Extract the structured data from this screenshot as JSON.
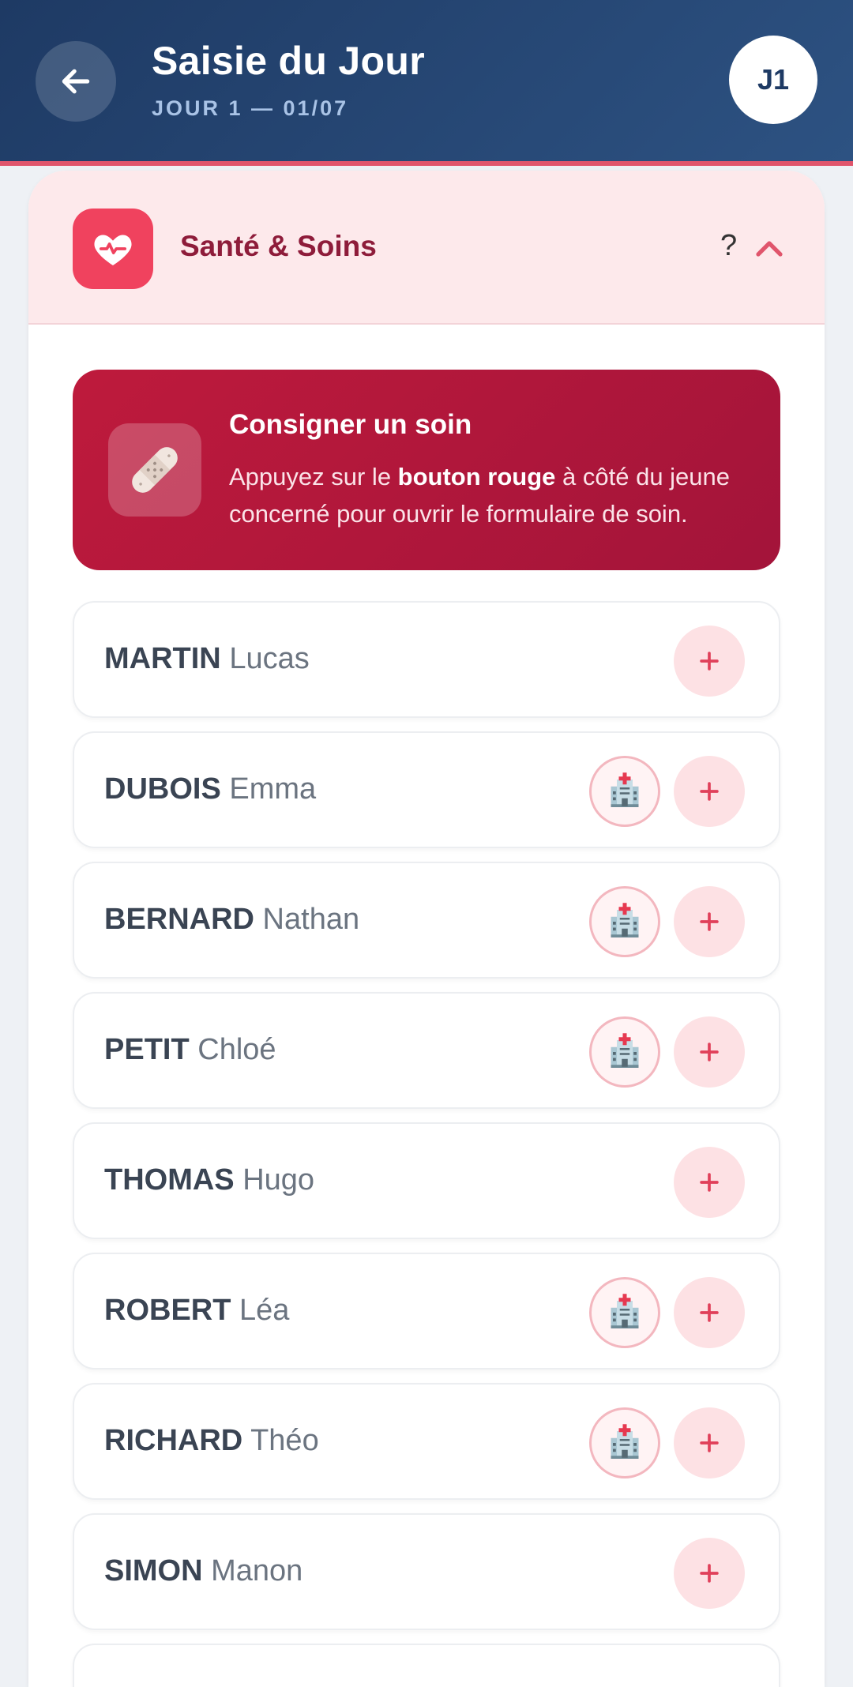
{
  "header": {
    "title": "Saisie du Jour",
    "subtitle": "JOUR 1 — 01/07",
    "day_badge": "J1",
    "back_icon": "arrow-left-icon",
    "accent": "#e0556c"
  },
  "section": {
    "title": "Santé & Soins",
    "help": "?",
    "icon": "heart-pulse-icon",
    "expanded": true
  },
  "info": {
    "title": "Consigner un soin",
    "text_before": "Appuyez sur le ",
    "text_bold": "bouton rouge",
    "text_after": " à côté du jeune concerné pour ouvrir le formulaire de soin.",
    "icon": "bandage-icon"
  },
  "rows": [
    {
      "last": "MARTIN",
      "first": "Lucas",
      "has_record": false
    },
    {
      "last": "DUBOIS",
      "first": "Emma",
      "has_record": true
    },
    {
      "last": "BERNARD",
      "first": "Nathan",
      "has_record": true
    },
    {
      "last": "PETIT",
      "first": "Chloé",
      "has_record": true
    },
    {
      "last": "THOMAS",
      "first": "Hugo",
      "has_record": false
    },
    {
      "last": "ROBERT",
      "first": "Léa",
      "has_record": true
    },
    {
      "last": "RICHARD",
      "first": "Théo",
      "has_record": true
    },
    {
      "last": "SIMON",
      "first": "Manon",
      "has_record": false
    }
  ],
  "colors": {
    "header_bg": "#1e3a64",
    "section_bg": "#fde9eb",
    "info_bg": "#be1a3c",
    "add_button_bg": "#fde1e4",
    "plus": "#e0405a"
  }
}
